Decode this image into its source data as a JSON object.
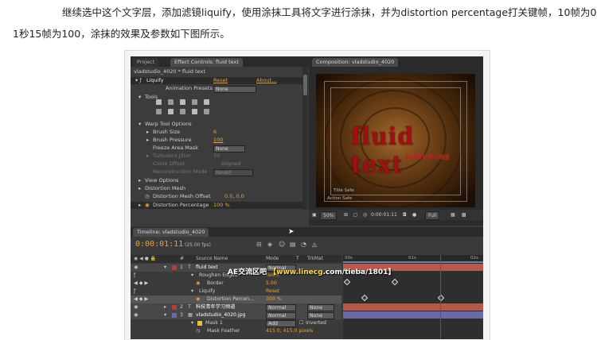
{
  "intro": {
    "line1": "继续选中这个文字层，添加滤镜liquify，使用涂抹工具将文字进行涂抹，并为distortion percentage打关键帧，10帧为0，",
    "line2": "1秒15帧为100，涂抹的效果及参数如下图所示。"
  },
  "tabs": {
    "project": "Project",
    "effect_controls": "Effect Controls: fluid text",
    "composition": "Composition: vladstudio_4020"
  },
  "effect_controls": {
    "path": "vladstudio_4020 * fluid text",
    "effect_name": "Liquify",
    "reset": "Reset",
    "about": "About...",
    "presets_label": "Animation Presets:",
    "presets_value": "None",
    "tools_label": "Tools",
    "warp_options": "Warp Tool Options",
    "brush_size_label": "Brush Size",
    "brush_size_value": "6",
    "brush_pressure_label": "Brush Pressure",
    "brush_pressure_value": "100",
    "freeze_label": "Freeze Area Mask",
    "freeze_value": "None",
    "turbulent_label": "Turbulent Jitter",
    "turbulent_value": "70",
    "clone_label": "Clone Offset",
    "clone_value": "Aligned",
    "recon_label": "Reconstruction Mode",
    "recon_value": "Revert",
    "view_options": "View Options",
    "mesh_label": "Distortion Mesh",
    "mesh_offset_label": "Distortion Mesh Offset",
    "mesh_offset_value": "0.0, 0.0",
    "distortion_label": "Distortion Percentage",
    "distortion_value": "100 %"
  },
  "composition": {
    "text_main": "fluid text",
    "text_sub": "科技青年学习频道",
    "title_safe": "Title Safe",
    "action_safe": "Action Safe",
    "zoom": "50%",
    "timecode": "0:00:01:11",
    "resolution": "Full"
  },
  "timeline": {
    "tab": "Timeline: vladstudio_4020",
    "timecode": "0:00:01:11",
    "fps": "(25.00 fps)",
    "col_source": "Source Name",
    "col_mode": "Mode",
    "col_t": "T",
    "col_trkmat": "TrkMat",
    "col_num": "#",
    "ruler": [
      "00s",
      "01s",
      "02s"
    ],
    "rows": [
      {
        "num": "1",
        "name": "fluid text",
        "mode": "Normal",
        "trkmat": "",
        "type": "layer"
      },
      {
        "num": "",
        "name": "Roughen Edges",
        "mode": "",
        "value": "Reset",
        "type": "effect"
      },
      {
        "num": "",
        "name": "Border",
        "mode": "",
        "value": "5.00",
        "type": "prop"
      },
      {
        "num": "",
        "name": "Liquify",
        "mode": "",
        "value": "Reset",
        "type": "effect"
      },
      {
        "num": "",
        "name": "Distortion Percen...",
        "mode": "",
        "value": "100 %",
        "type": "prop"
      },
      {
        "num": "2",
        "name": "科技青年学习频道",
        "mode": "Normal",
        "trkmat": "None",
        "type": "layer"
      },
      {
        "num": "3",
        "name": "vladstudio_4020.jpg",
        "mode": "Normal",
        "trkmat": "None",
        "type": "layer"
      },
      {
        "num": "",
        "name": "Mask 1",
        "mode": "Add",
        "value": "Inverted",
        "type": "effect"
      },
      {
        "num": "",
        "name": "Mask Feather",
        "mode": "",
        "value": "415.0, 415.0 pixels",
        "type": "prop"
      }
    ]
  },
  "watermark": {
    "left": "AE交流区吧",
    "url": "【www.linecg",
    "rest": ".com/tieba/1801】"
  },
  "colors": {
    "accent": "#e8a23a",
    "panel": "#3a3a3a",
    "text_red": "#a01010",
    "playhead": "#e02020"
  }
}
